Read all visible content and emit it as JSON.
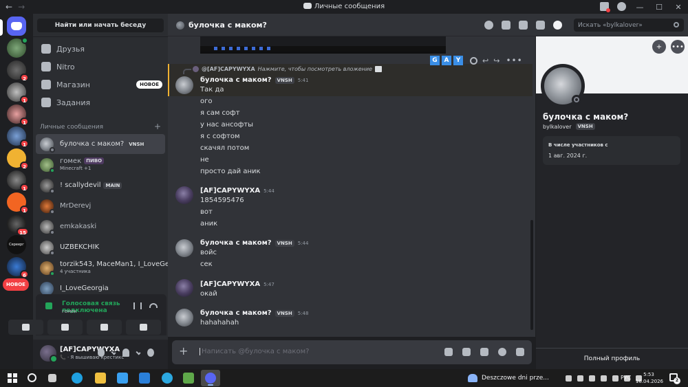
{
  "window": {
    "title": "Личные сообщения"
  },
  "sidebar": {
    "find_label": "Найти или начать беседу",
    "nav": [
      {
        "label": "Друзья",
        "icon": "friends-icon"
      },
      {
        "label": "Nitro",
        "icon": "nitro-icon"
      },
      {
        "label": "Магазин",
        "icon": "shop-icon",
        "tag": "НОВОЕ"
      },
      {
        "label": "Задания",
        "icon": "quests-icon"
      }
    ],
    "dm_header": "Личные сообщения",
    "dms": [
      {
        "name": "булочка с маком?",
        "tag": "VNSH",
        "sub": ""
      },
      {
        "name": "гомек",
        "tag": "ПИВО",
        "sub": "Minecraft +1"
      },
      {
        "name": "! scallydevil",
        "tag": "MAIN",
        "sub": ""
      },
      {
        "name": "MrDerevj",
        "tag": "",
        "sub": ""
      },
      {
        "name": "emkakaski",
        "tag": "",
        "sub": ""
      },
      {
        "name": "UZBEKCHIK",
        "tag": "",
        "sub": ""
      },
      {
        "name": "torzik543, MaceMan1, I_LoveGe...",
        "tag": "",
        "sub": "4 участника"
      },
      {
        "name": "I_LoveGeorgia",
        "tag": "",
        "sub": ""
      }
    ]
  },
  "rail": {
    "badges": [
      "2",
      "1",
      "1",
      "1",
      "2",
      "1",
      "1",
      "15",
      "6",
      "1"
    ],
    "new_pill": "НОВОЕ",
    "server_label": "Сереерг"
  },
  "voice": {
    "status": "Голосовая связь подключена",
    "channel": "гомек"
  },
  "user": {
    "name": "[AF]CAPYWYXA",
    "status": "Я вышиваю крестикс"
  },
  "chat": {
    "title": "булочка с маком?",
    "search_placeholder": "Искать «bylkalover»",
    "reply": {
      "author": "@[AF]CAPYWYXA",
      "text": "Нажмите, чтобы посмотреть вложение"
    },
    "hover_letters": [
      "G",
      "A",
      "Y"
    ],
    "messages": [
      {
        "author": "булочка с маком?",
        "tag": "VNSH",
        "time": "5:41",
        "lines": [
          "Так да",
          "ого",
          "я сам софт",
          "у нас ансофты",
          "я с софтом",
          "скачял потом",
          "не",
          "просто дай аник"
        ]
      },
      {
        "author": "[AF]CAPYWYXA",
        "tag": "",
        "time": "5:44",
        "lines": [
          "1854595476",
          "вот",
          "аник"
        ]
      },
      {
        "author": "булочка с маком?",
        "tag": "VNSH",
        "time": "5:44",
        "lines": [
          "войс",
          "сек"
        ]
      },
      {
        "author": "[AF]CAPYWYXA",
        "tag": "",
        "time": "5:47",
        "lines": [
          "окай"
        ]
      },
      {
        "author": "булочка с маком?",
        "tag": "VNSH",
        "time": "5:48",
        "lines": [
          "hahahahah"
        ]
      }
    ],
    "composer_placeholder": "Написать @булочка с маком?"
  },
  "profile": {
    "name": "булочка с маком?",
    "username": "bylkalover",
    "tag": "VNSH",
    "member_since_label": "В числе участников с",
    "member_since": "1 авг. 2024 г.",
    "full_profile": "Полный профиль"
  },
  "taskbar": {
    "weather": "Deszczowe dni prze...",
    "lang": "РУС",
    "time": "5:53",
    "date": "16.04.2026",
    "notifications": "2"
  }
}
